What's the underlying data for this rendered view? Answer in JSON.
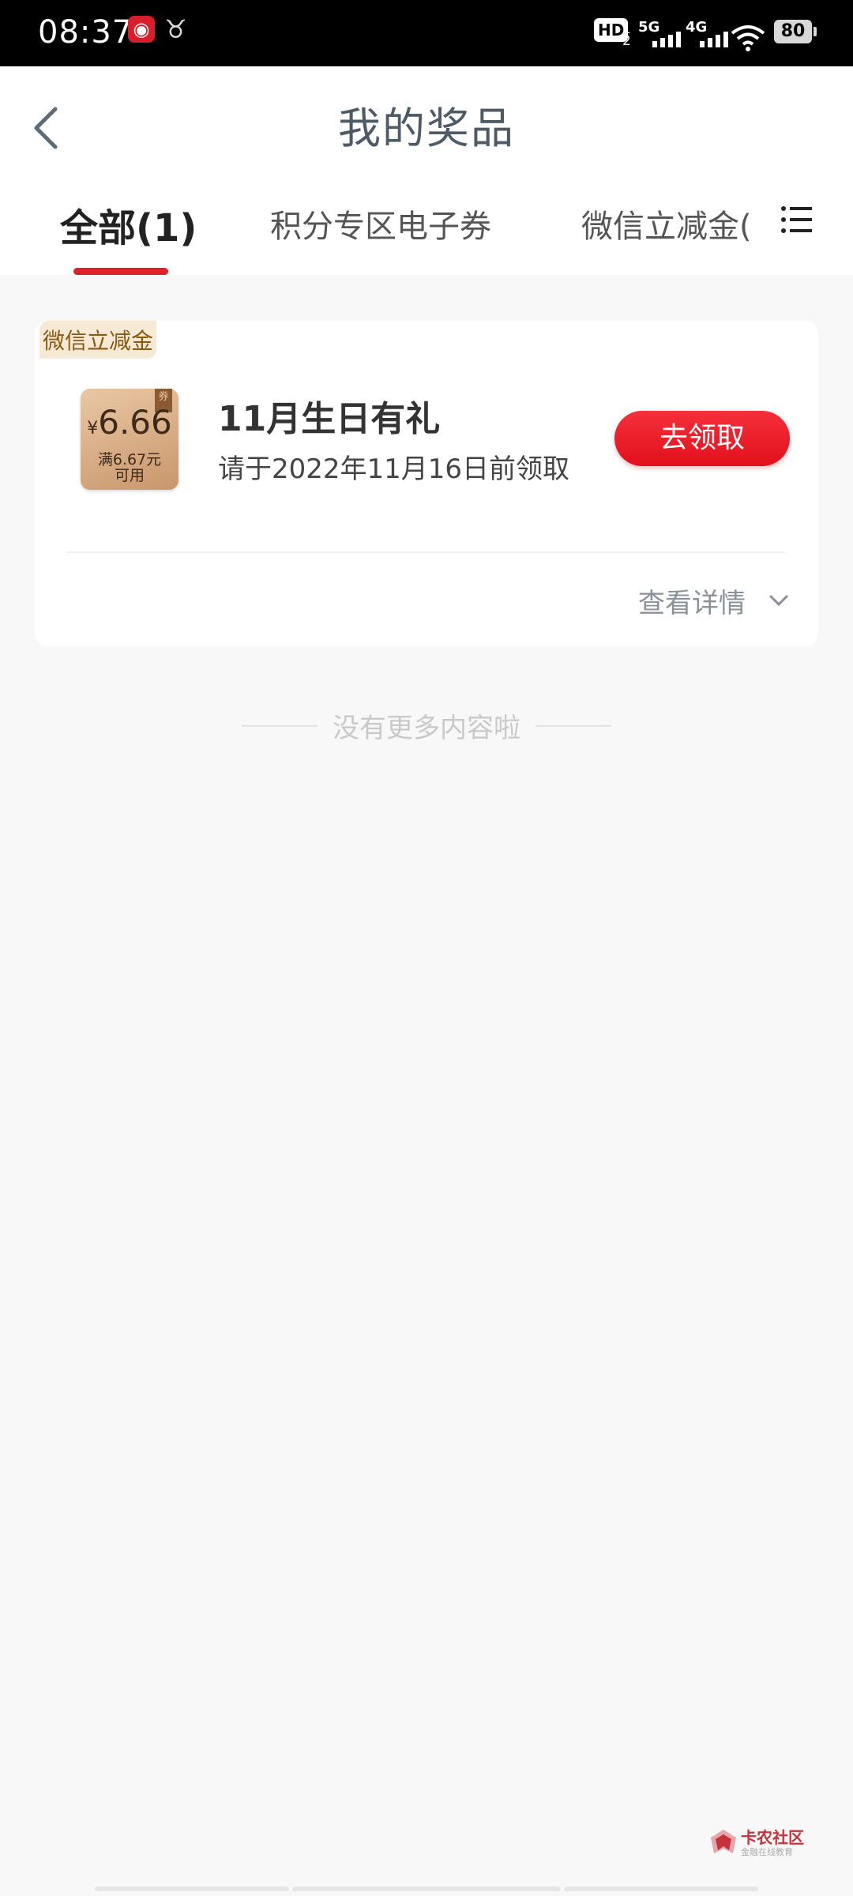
{
  "status_bar": {
    "time": "08:37",
    "hd_label": "HD",
    "hd_sub": "1\n2",
    "net1": "5G",
    "net2": "4G",
    "battery": "80"
  },
  "header": {
    "title": "我的奖品",
    "tabs": [
      {
        "label": "全部(1)"
      },
      {
        "label": "积分专区电子券"
      },
      {
        "label": "微信立减金("
      }
    ]
  },
  "prize_card": {
    "tag": "微信立减金",
    "coupon": {
      "currency": "¥",
      "amount": "6.66",
      "condition_line1": "满6.67元",
      "condition_line2": "可用",
      "ribbon": "券"
    },
    "name": "11月生日有礼",
    "deadline": "请于2022年11月16日前领取",
    "claim_label": "去领取",
    "detail_label": "查看详情"
  },
  "list_end_text": "没有更多内容啦",
  "watermark": {
    "name": "卡农社区",
    "sub": "金融在线教育"
  },
  "colors": {
    "accent_red": "#e1212a",
    "status_bar_bg": "#000000",
    "page_bg": "#f8f8f8",
    "tag_bg": "#f6ead7"
  }
}
